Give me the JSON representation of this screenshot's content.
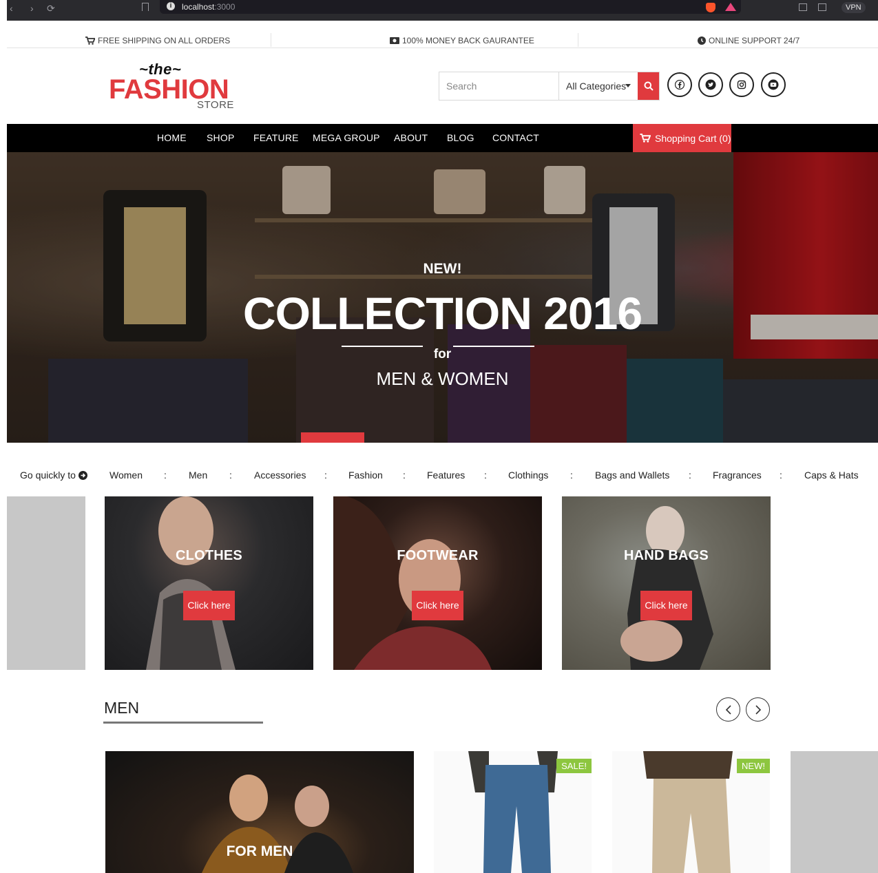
{
  "browser": {
    "url_host": "localhost",
    "url_port": ":3000",
    "vpn_label": "VPN"
  },
  "topbar": {
    "shipping": "FREE SHIPPING ON ALL ORDERS",
    "money_back": "100% MONEY BACK GAURANTEE",
    "support": "ONLINE SUPPORT 24/7"
  },
  "logo": {
    "the": "~the~",
    "fashion": "FASHION",
    "store": "STORE"
  },
  "search": {
    "placeholder": "Search",
    "category": "All Categories"
  },
  "social": [
    "facebook-icon",
    "twitter-icon",
    "instagram-icon",
    "youtube-icon"
  ],
  "nav": {
    "items": [
      "HOME",
      "SHOP",
      "FEATURE",
      "MEGA GROUP",
      "ABOUT",
      "BLOG",
      "CONTACT"
    ],
    "cart": "Shopping Cart (0)"
  },
  "hero": {
    "kicker": "NEW!",
    "title": "COLLECTION 2016",
    "for": "for",
    "audience": "MEN & WOMEN"
  },
  "quick": {
    "lead": "Go quickly to",
    "links": [
      "Women",
      "Men",
      "Accessories",
      "Fashion",
      "Features",
      "Clothings",
      "Bags and Wallets",
      "Fragrances",
      "Caps & Hats"
    ],
    "separator": ":"
  },
  "categories": [
    {
      "label": "CLOTHES",
      "button": "Click here"
    },
    {
      "label": "FOOTWEAR",
      "button": "Click here"
    },
    {
      "label": "HAND BAGS",
      "button": "Click here"
    }
  ],
  "men_section": {
    "title": "MEN",
    "feature_label": "FOR MEN",
    "badges": [
      "SALE!",
      "NEW!"
    ]
  },
  "colors": {
    "brand_red": "#e03a3e",
    "badge_green": "#8dc63f",
    "nav_black": "#000000"
  }
}
